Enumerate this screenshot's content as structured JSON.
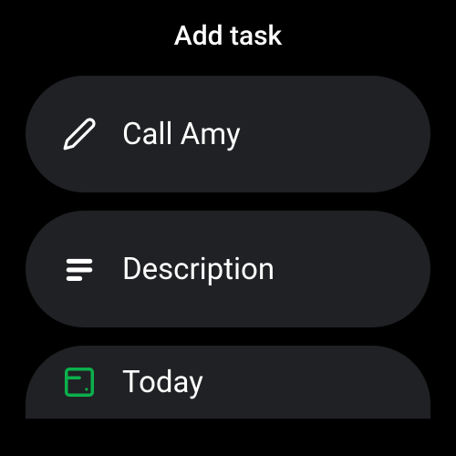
{
  "title": "Add task",
  "items": {
    "name": {
      "label": "Call Amy"
    },
    "description": {
      "label": "Description"
    },
    "date": {
      "label": "Today"
    }
  },
  "colors": {
    "accent": "#0bb04c"
  }
}
